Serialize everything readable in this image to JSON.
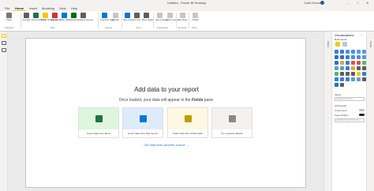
{
  "window": {
    "title": "Untitled - Power BI Desktop",
    "user": "Colin Dumont",
    "controls": [
      "–",
      "□",
      "✕"
    ]
  },
  "menu": {
    "tabs": [
      "File",
      "Home",
      "Insert",
      "Modeling",
      "View",
      "Help"
    ],
    "active": "Home"
  },
  "ribbon": {
    "buttons": [
      {
        "label": "Paste",
        "icon": "paste-icon",
        "color": "#7a7574"
      },
      {
        "label": "Get data",
        "icon": "get-data-icon",
        "color": "#605e5c"
      },
      {
        "label": "Excel workbook",
        "icon": "excel-icon",
        "color": "#217346"
      },
      {
        "label": "Power BI datasets",
        "icon": "dataset-icon",
        "color": "#f2c811"
      },
      {
        "label": "SQL Server",
        "icon": "sql-icon",
        "color": "#d13438"
      },
      {
        "label": "Enter data",
        "icon": "table-icon",
        "color": "#0078d4"
      },
      {
        "label": "Dataverse",
        "icon": "dataverse-icon",
        "color": "#0b6a0b"
      },
      {
        "label": "Recent sources",
        "icon": "recent-icon",
        "color": "#605e5c"
      },
      {
        "label": "Transform data",
        "icon": "transform-icon",
        "color": "#0078d4"
      },
      {
        "label": "Refresh",
        "icon": "refresh-icon",
        "color": "#c8c6c4"
      },
      {
        "label": "New visual",
        "icon": "new-visual-icon",
        "color": "#0078d4"
      },
      {
        "label": "Text box",
        "icon": "textbox-icon",
        "color": "#605e5c"
      },
      {
        "label": "More visuals",
        "icon": "more-visuals-icon",
        "color": "#605e5c"
      },
      {
        "label": "New measure",
        "icon": "measure-icon",
        "color": "#c8c6c4"
      },
      {
        "label": "Quick measure",
        "icon": "quick-measure-icon",
        "color": "#c8c6c4"
      },
      {
        "label": "Sensitivity",
        "icon": "sensitivity-icon",
        "color": "#c8c6c4"
      },
      {
        "label": "Publish",
        "icon": "publish-icon",
        "color": "#c8c6c4"
      }
    ],
    "groups": [
      "Clipboard",
      "Data",
      "Queries",
      "Insert",
      "Calculations",
      "Sensitivity",
      "Share"
    ]
  },
  "canvas": {
    "title": "Add data to your report",
    "subtitle_pre": "Once loaded, your data will appear in the ",
    "subtitle_bold": "Fields",
    "subtitle_post": " pane.",
    "cards": [
      {
        "caption": "Import data from Excel",
        "bg": "#dff6dd",
        "icon_color": "#217346"
      },
      {
        "caption": "Import data from SQL Server",
        "bg": "#deecf9",
        "icon_color": "#0078d4"
      },
      {
        "caption": "Paste data into a blank table",
        "bg": "#fff8e1",
        "icon_color": "#c19c00"
      },
      {
        "caption": "Try a sample dataset",
        "bg": "#f3f2f1",
        "icon_color": "#8a8886"
      }
    ],
    "get_data_link": "Get data from another source →"
  },
  "panes": {
    "filters_label": "Filters",
    "fields_label": "Fields",
    "visualizations": {
      "title": "Visualizations",
      "build_visual": "Build visual",
      "values_label": "Values",
      "values_placeholder": "Add data fields here",
      "drillthrough_label": "Drill through",
      "cross_report_label": "Cross-report",
      "keep_all_filters_label": "Keep all filters",
      "drillthrough_placeholder": "Add drill-through fields here"
    }
  }
}
